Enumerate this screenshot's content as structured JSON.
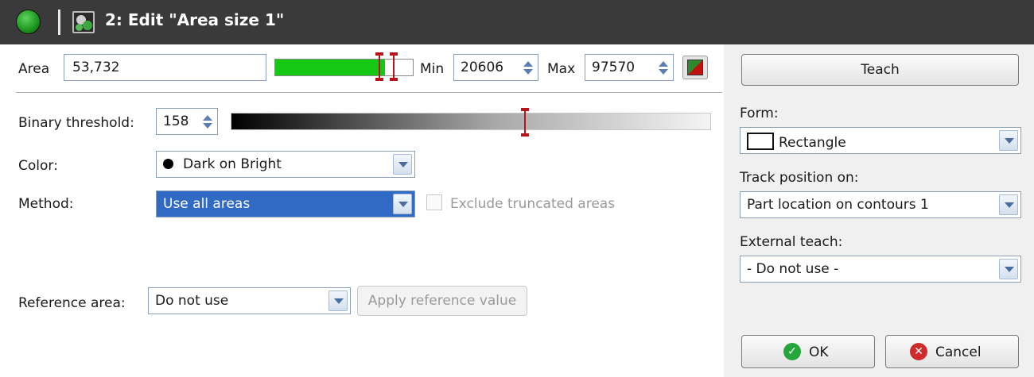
{
  "window": {
    "title": "2: Edit \"Area size 1\"",
    "app_icon": "green-sphere-icon",
    "tool_icon": "blob-analysis-icon"
  },
  "area": {
    "label": "Area",
    "value": "53,732",
    "bar_fill_fraction": 0.8,
    "min_label": "Min",
    "min_value": "20606",
    "max_label": "Max",
    "max_value": "97570",
    "reset_icon": "red-green-flag-icon"
  },
  "threshold": {
    "label": "Binary threshold:",
    "value": "158"
  },
  "color": {
    "label": "Color:",
    "selected": "Dark on Bright"
  },
  "method": {
    "label": "Method:",
    "selected": "Use all areas",
    "exclude_label": "Exclude truncated areas"
  },
  "reference": {
    "label": "Reference area:",
    "selected": "Do not use",
    "apply_label": "Apply reference value"
  },
  "sidebar": {
    "teach_label": "Teach",
    "form_label": "Form:",
    "form_value": "Rectangle",
    "track_label": "Track position on:",
    "track_value": "Part location on contours 1",
    "external_label": "External teach:",
    "external_value": "- Do not use -",
    "ok_label": "OK",
    "cancel_label": "Cancel"
  },
  "colors": {
    "titlebar": "#3a3a3a",
    "area_bar_fill": "#14c814",
    "marker": "#b8131b",
    "selection": "#316ac5"
  }
}
